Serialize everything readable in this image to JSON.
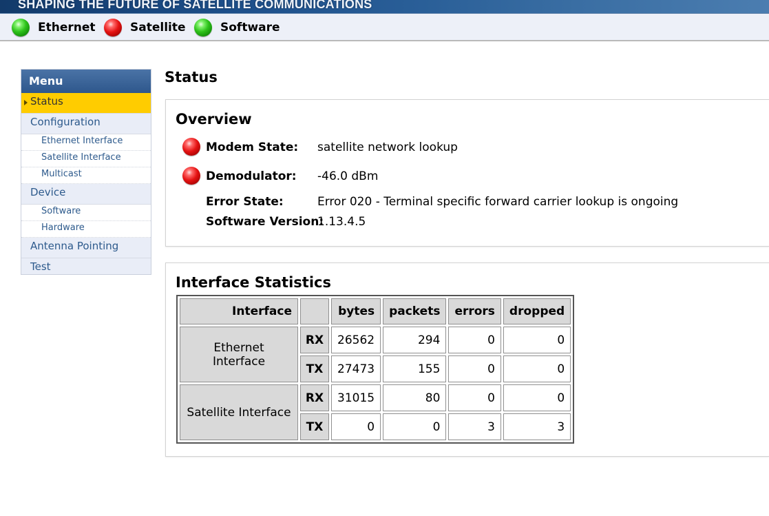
{
  "banner": {
    "text": "SHAPING THE FUTURE OF SATELLITE COMMUNICATIONS"
  },
  "statusbar": {
    "items": [
      {
        "label": "Ethernet",
        "state": "green"
      },
      {
        "label": "Satellite",
        "state": "red"
      },
      {
        "label": "Software",
        "state": "green"
      }
    ]
  },
  "menu": {
    "header": "Menu",
    "items": {
      "status": "Status",
      "configuration": "Configuration",
      "ethernet_interface": "Ethernet Interface",
      "satellite_interface": "Satellite Interface",
      "multicast": "Multicast",
      "device": "Device",
      "software": "Software",
      "hardware": "Hardware",
      "antenna_pointing": "Antenna Pointing",
      "test": "Test"
    }
  },
  "page": {
    "title": "Status"
  },
  "overview": {
    "title": "Overview",
    "modem_state": {
      "label": "Modem State:",
      "value": "satellite network lookup",
      "led": "red"
    },
    "demodulator": {
      "label": "Demodulator:",
      "value": "-46.0 dBm",
      "led": "red"
    },
    "error_state": {
      "label": "Error State:",
      "value": "Error 020 - Terminal specific forward carrier lookup is ongoing"
    },
    "software_version": {
      "label": "Software Version:",
      "value": "1.13.4.5"
    }
  },
  "stats": {
    "title": "Interface Statistics",
    "headers": {
      "interface": "Interface",
      "dir": "",
      "bytes": "bytes",
      "packets": "packets",
      "errors": "errors",
      "dropped": "dropped"
    },
    "ethernet": {
      "name": "Ethernet Interface",
      "rx": {
        "dir": "RX",
        "bytes": "26562",
        "packets": "294",
        "errors": "0",
        "dropped": "0"
      },
      "tx": {
        "dir": "TX",
        "bytes": "27473",
        "packets": "155",
        "errors": "0",
        "dropped": "0"
      }
    },
    "satellite": {
      "name": "Satellite Interface",
      "rx": {
        "dir": "RX",
        "bytes": "31015",
        "packets": "80",
        "errors": "0",
        "dropped": "0"
      },
      "tx": {
        "dir": "TX",
        "bytes": "0",
        "packets": "0",
        "errors": "3",
        "dropped": "3"
      }
    }
  },
  "colors": {
    "menu_header": "#2e578c",
    "menu_active": "#ffcc00",
    "menu_link": "#2d5a8c",
    "led_green": "#2fc31c",
    "led_red": "#e51313"
  }
}
